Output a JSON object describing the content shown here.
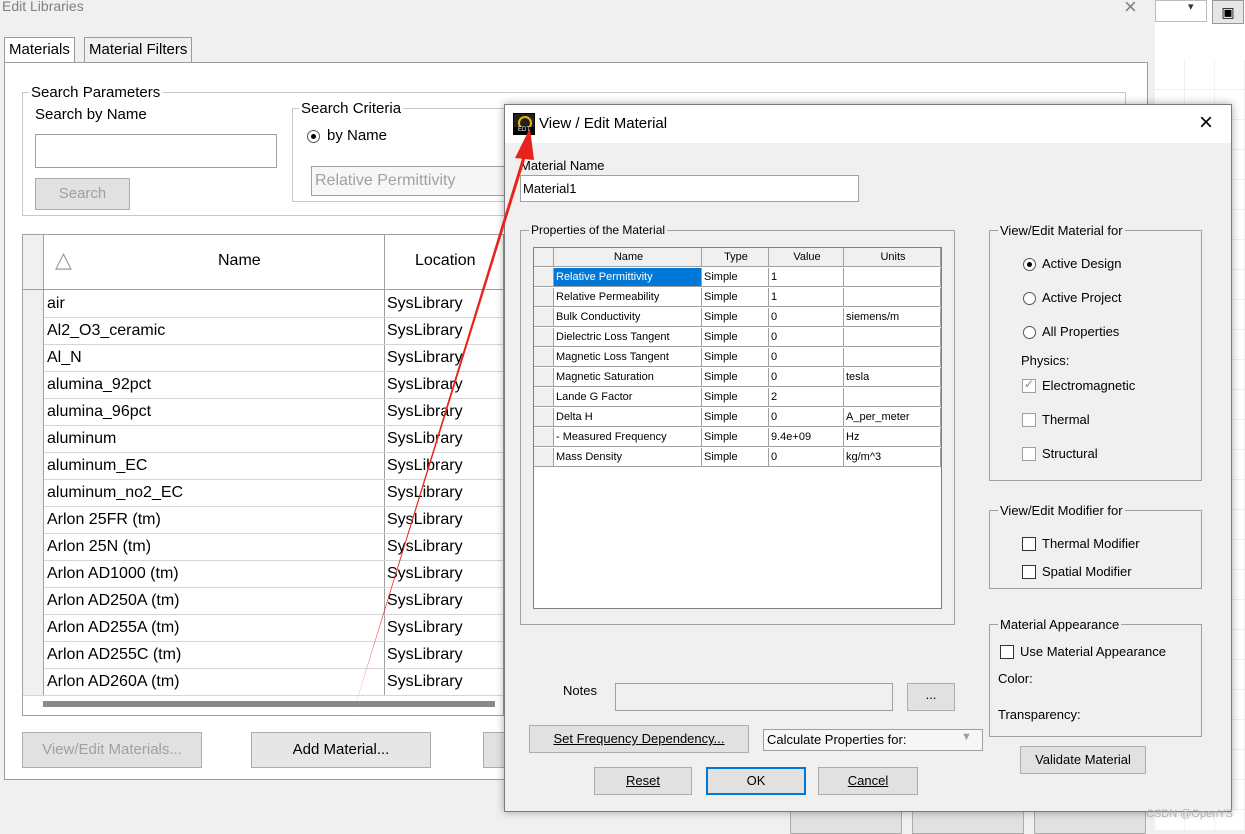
{
  "main_window": {
    "title": "Edit Libraries",
    "tabs": [
      "Materials",
      "Material Filters"
    ],
    "search_params": {
      "group_title": "Search Parameters",
      "search_by_name_label": "Search by Name",
      "search_value": "",
      "search_button": "Search",
      "criteria_title": "Search Criteria",
      "by_name_label": "by Name",
      "property_select": "Relative Permittivity"
    },
    "table": {
      "columns": [
        "Name",
        "Location"
      ],
      "rows": [
        {
          "name": "air",
          "location": "SysLibrary"
        },
        {
          "name": "Al2_O3_ceramic",
          "location": "SysLibrary"
        },
        {
          "name": "Al_N",
          "location": "SysLibrary"
        },
        {
          "name": "alumina_92pct",
          "location": "SysLibrary"
        },
        {
          "name": "alumina_96pct",
          "location": "SysLibrary"
        },
        {
          "name": "aluminum",
          "location": "SysLibrary"
        },
        {
          "name": "aluminum_EC",
          "location": "SysLibrary"
        },
        {
          "name": "aluminum_no2_EC",
          "location": "SysLibrary"
        },
        {
          "name": "Arlon 25FR (tm)",
          "location": "SysLibrary"
        },
        {
          "name": "Arlon 25N (tm)",
          "location": "SysLibrary"
        },
        {
          "name": "Arlon AD1000 (tm)",
          "location": "SysLibrary"
        },
        {
          "name": "Arlon AD250A (tm)",
          "location": "SysLibrary"
        },
        {
          "name": "Arlon AD255A (tm)",
          "location": "SysLibrary"
        },
        {
          "name": "Arlon AD255C (tm)",
          "location": "SysLibrary"
        },
        {
          "name": "Arlon AD260A (tm)",
          "location": "SysLibrary"
        }
      ]
    },
    "buttons": {
      "view_edit": "View/Edit Materials...",
      "add_material": "Add Material..."
    }
  },
  "dialog": {
    "title": "View / Edit Material",
    "material_name_label": "Material Name",
    "material_name_value": "Material1",
    "properties_group": "Properties of the Material",
    "prop_columns": [
      "Name",
      "Type",
      "Value",
      "Units"
    ],
    "properties": [
      {
        "name": "Relative Permittivity",
        "type": "Simple",
        "value": "1",
        "units": ""
      },
      {
        "name": "Relative Permeability",
        "type": "Simple",
        "value": "1",
        "units": ""
      },
      {
        "name": "Bulk Conductivity",
        "type": "Simple",
        "value": "0",
        "units": "siemens/m"
      },
      {
        "name": "Dielectric Loss Tangent",
        "type": "Simple",
        "value": "0",
        "units": ""
      },
      {
        "name": "Magnetic Loss Tangent",
        "type": "Simple",
        "value": "0",
        "units": ""
      },
      {
        "name": "Magnetic Saturation",
        "type": "Simple",
        "value": "0",
        "units": "tesla"
      },
      {
        "name": "Lande G Factor",
        "type": "Simple",
        "value": "2",
        "units": ""
      },
      {
        "name": "Delta H",
        "type": "Simple",
        "value": "0",
        "units": "A_per_meter"
      },
      {
        "name": "- Measured Frequency",
        "type": "Simple",
        "value": "9.4e+09",
        "units": "Hz"
      },
      {
        "name": "Mass Density",
        "type": "Simple",
        "value": "0",
        "units": "kg/m^3"
      }
    ],
    "selected_property_index": 0,
    "view_edit_for": {
      "title": "View/Edit Material for",
      "options": [
        "Active Design",
        "Active Project",
        "All Properties"
      ],
      "selected": "Active Design",
      "physics_label": "Physics:",
      "physics": [
        {
          "label": "Electromagnetic",
          "checked": true
        },
        {
          "label": "Thermal",
          "checked": false
        },
        {
          "label": "Structural",
          "checked": false
        }
      ]
    },
    "modifier_for": {
      "title": "View/Edit Modifier for",
      "thermal": "Thermal Modifier",
      "spatial": "Spatial Modifier"
    },
    "appearance": {
      "title": "Material Appearance",
      "use_label": "Use Material Appearance",
      "color_label": "Color:",
      "transparency_label": "Transparency:"
    },
    "notes_label": "Notes",
    "notes_browse": "...",
    "set_freq_button": "Set Frequency Dependency...",
    "calc_select": "Calculate Properties for:",
    "validate_button": "Validate Material",
    "reset_button": "Reset",
    "ok_button": "OK",
    "cancel_button": "Cancel"
  },
  "watermark": "CSDN @OpenYS",
  "colors": {
    "selection": "#0078d7",
    "arrow": "#e8231a"
  }
}
